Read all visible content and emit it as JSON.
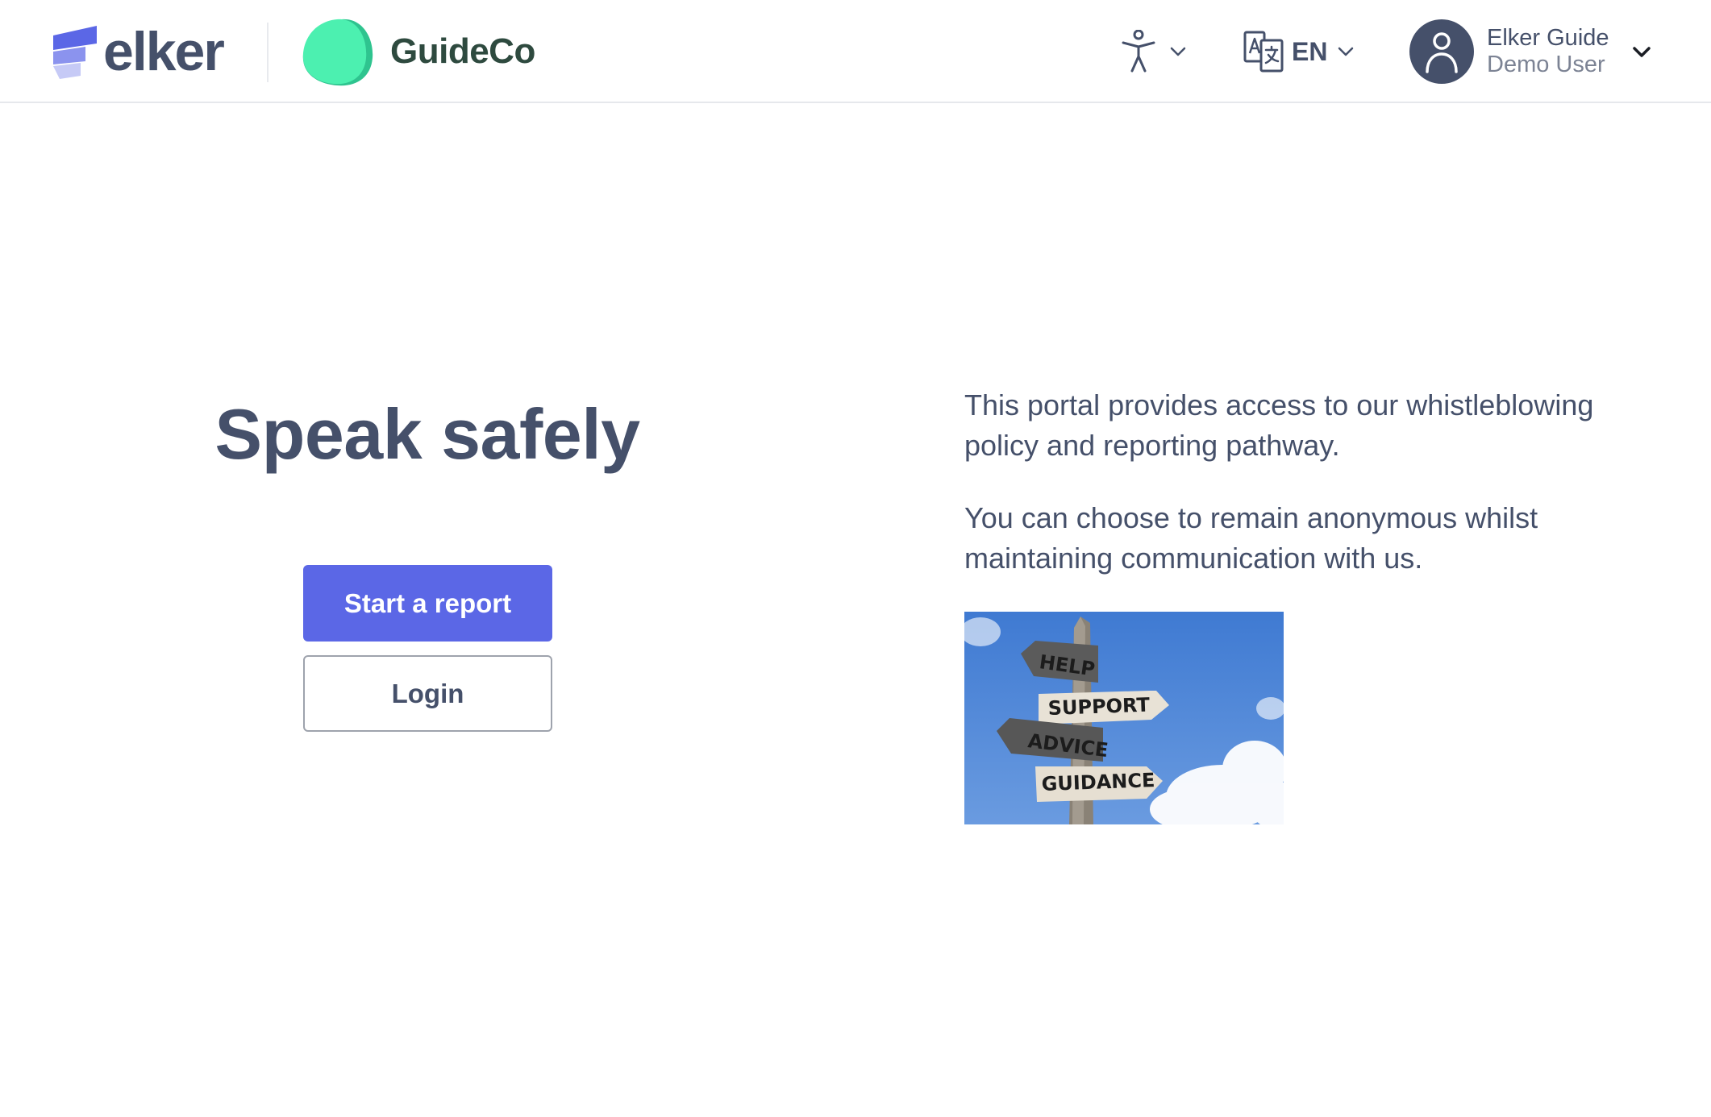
{
  "header": {
    "logo_text": "elker",
    "client_name": "GuideCo",
    "language_code": "EN",
    "user_name": "Elker Guide",
    "user_role": "Demo User",
    "icons": {
      "accessibility": "accessibility-icon",
      "translate": "translate-icon",
      "avatar": "user-avatar-icon",
      "chevron": "chevron-down-icon"
    }
  },
  "main": {
    "headline": "Speak safely",
    "start_report_label": "Start a report",
    "login_label": "Login",
    "intro_paragraphs": [
      "This portal provides access to our whistleblowing policy and reporting pathway.",
      "You can choose to remain anonymous whilst maintaining communication with us."
    ],
    "signpost_labels": [
      "HELP",
      "SUPPORT",
      "ADVICE",
      "GUIDANCE"
    ]
  },
  "colors": {
    "primary": "#5b67e6",
    "text": "#45506a",
    "client_green": "#4cf0b0",
    "sky": "#4c86d6"
  }
}
